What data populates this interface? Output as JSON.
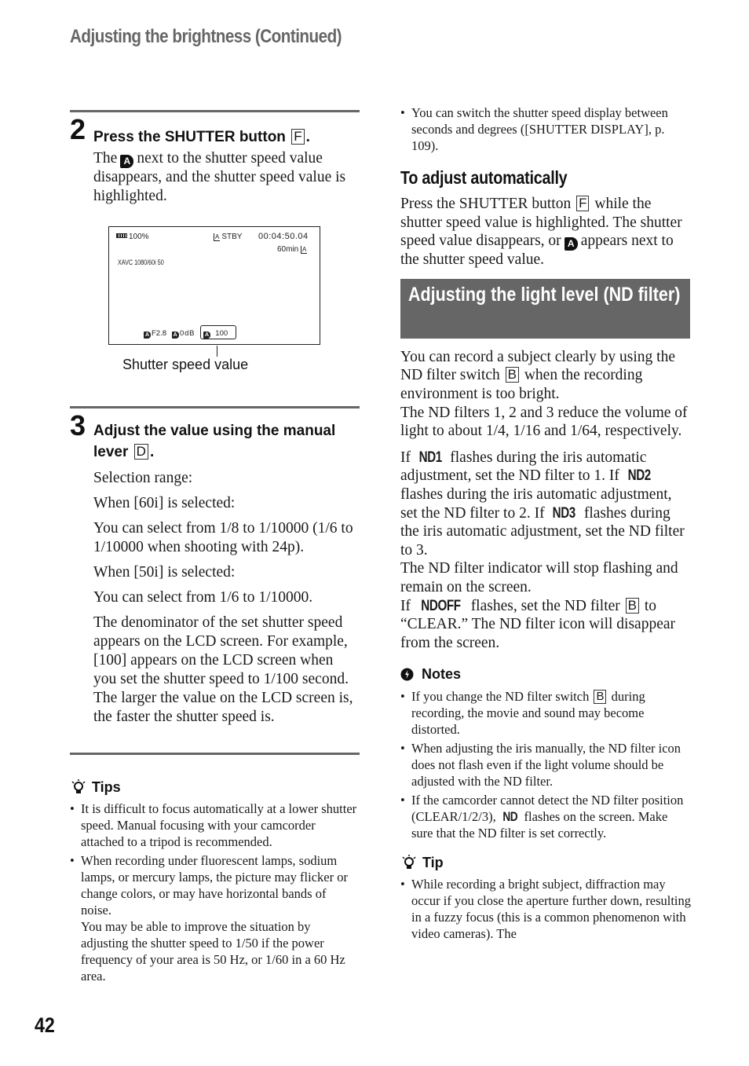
{
  "running_head": "Adjusting the brightness (Continued)",
  "page_number": "42",
  "step2": {
    "number": "2",
    "title_pre": "Press the SHUTTER button",
    "title_key": "F",
    "title_post": ".",
    "body_pre": "The",
    "body_icon": "A",
    "body_post": "next to the shutter speed value disappears, and the shutter speed value is highlighted."
  },
  "lcd": {
    "battery": "100%",
    "media_status": "STBY",
    "timecode": "00:04:50.04",
    "remaining": "60min",
    "card_label": "A",
    "format": "XAVC 1080/60i 50",
    "iris": "F2.8",
    "gain": "0dB",
    "shutter": "100",
    "auto_icon": "A",
    "caption": "Shutter speed value"
  },
  "step3": {
    "number": "3",
    "title_pre": "Adjust the value using the manual lever",
    "title_key": "D",
    "title_post": ".",
    "paragraphs": [
      "Selection range:",
      "When [60i] is selected:",
      "You can select from 1/8 to 1/10000 (1/6 to 1/10000 when shooting with 24p).",
      "When [50i] is selected:",
      "You can select from 1/6 to 1/10000.",
      "The denominator of the set shutter speed appears on the LCD screen. For example, [100] appears on the LCD screen when you set the shutter speed to 1/100 second. The larger the value on the LCD screen is, the faster the shutter speed is."
    ]
  },
  "tips": {
    "heading": "Tips",
    "items": [
      "It is difficult to focus automatically at a lower shutter speed. Manual focusing with your camcorder attached to a tripod is recommended.",
      "When recording under fluorescent lamps, sodium lamps, or mercury lamps, the picture may flicker or change colors, or may have horizontal bands of noise."
    ],
    "item2_extra": "You may be able to improve the situation by adjusting the shutter speed to 1/50 if the power frequency of your area is 50 Hz, or 1/60 in a 60 Hz area."
  },
  "right_bullet": "You can switch the shutter speed display between seconds and degrees ([SHUTTER DISPLAY], p. 109).",
  "auto_adjust": {
    "heading": "To adjust automatically",
    "body_1": "Press the SHUTTER button",
    "key": "F",
    "body_2": "while the shutter speed value is highlighted. The shutter speed value disappears, or",
    "icon": "A",
    "body_3": "appears next to the shutter speed value."
  },
  "nd_section": {
    "banner": "Adjusting the light level (ND filter)",
    "intro_1": "You can record a subject clearly by using the ND filter switch",
    "key": "B",
    "intro_2": "when the recording environment is too bright.",
    "intro_3": "The ND filters 1, 2 and 3 reduce the volume of light to about 1/4, 1/16 and 1/64, respectively.",
    "p2": {
      "if1": "If",
      "nd1": "ND1",
      "t1": "flashes during the iris automatic adjustment, set the ND filter to 1. If",
      "nd2": "ND2",
      "t2": "flashes during the iris automatic adjustment, set the ND filter to 2. If",
      "nd3": "ND3",
      "t3": "flashes during the iris automatic adjustment, set the ND filter to 3.",
      "t4": "The ND filter indicator will stop flashing and remain on the screen.",
      "if2": "If",
      "ndoff": "NDOFF",
      "t5": "flashes, set the ND filter",
      "key": "B",
      "t6": "to “CLEAR.” The ND filter icon will disappear from the screen."
    }
  },
  "notes": {
    "heading": "Notes",
    "n1_pre": "If you change the ND filter switch",
    "n1_key": "B",
    "n1_post": "during recording, the movie and sound may become distorted.",
    "n2": "When adjusting the iris manually, the ND filter icon does not flash even if the light volume should be adjusted with the ND filter.",
    "n3_pre": "If the camcorder cannot detect the ND filter position (CLEAR/1/2/3),",
    "n3_icon": "ND",
    "n3_post": "flashes on the screen. Make sure that the ND filter is set correctly."
  },
  "tip": {
    "heading": "Tip",
    "item": "While recording a bright subject, diffraction may occur if you close the aperture further down, resulting in a fuzzy focus (this is a common phenomenon with video cameras). The"
  }
}
